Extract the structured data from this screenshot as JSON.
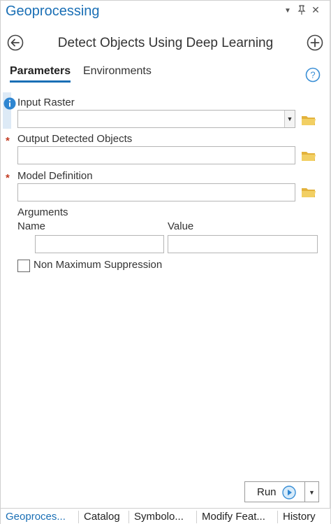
{
  "pane": {
    "title": "Geoprocessing",
    "title_icons": [
      "dropdown-arrow-icon",
      "pin-icon",
      "close-icon"
    ]
  },
  "header": {
    "title": "Detect Objects Using Deep Learning",
    "back_icon": "back-arrow-circle-icon",
    "add_icon": "plus-circle-icon"
  },
  "tabs": {
    "parameters": "Parameters",
    "environments": "Environments",
    "active": "Parameters",
    "help_icon": "help-question-icon"
  },
  "params": {
    "input_raster": {
      "label": "Input Raster",
      "value": ""
    },
    "output_detected": {
      "label": "Output Detected Objects",
      "value": "",
      "required": true
    },
    "model_definition": {
      "label": "Model Definition",
      "value": "",
      "required": true
    },
    "arguments": {
      "label": "Arguments",
      "columns": [
        "Name",
        "Value"
      ],
      "row": {
        "name": "",
        "value": ""
      }
    },
    "nms": {
      "label": "Non Maximum Suppression",
      "checked": false
    },
    "required_marker": "*"
  },
  "run": {
    "label": "Run",
    "icon": "play-circle-icon"
  },
  "bottom_tabs": [
    "Geoproces...",
    "Catalog",
    "Symbolo...",
    "Modify Feat...",
    "History"
  ],
  "colors": {
    "accent": "#1a6fb5",
    "required": "#c23b22",
    "folder": "#e3b23c"
  }
}
